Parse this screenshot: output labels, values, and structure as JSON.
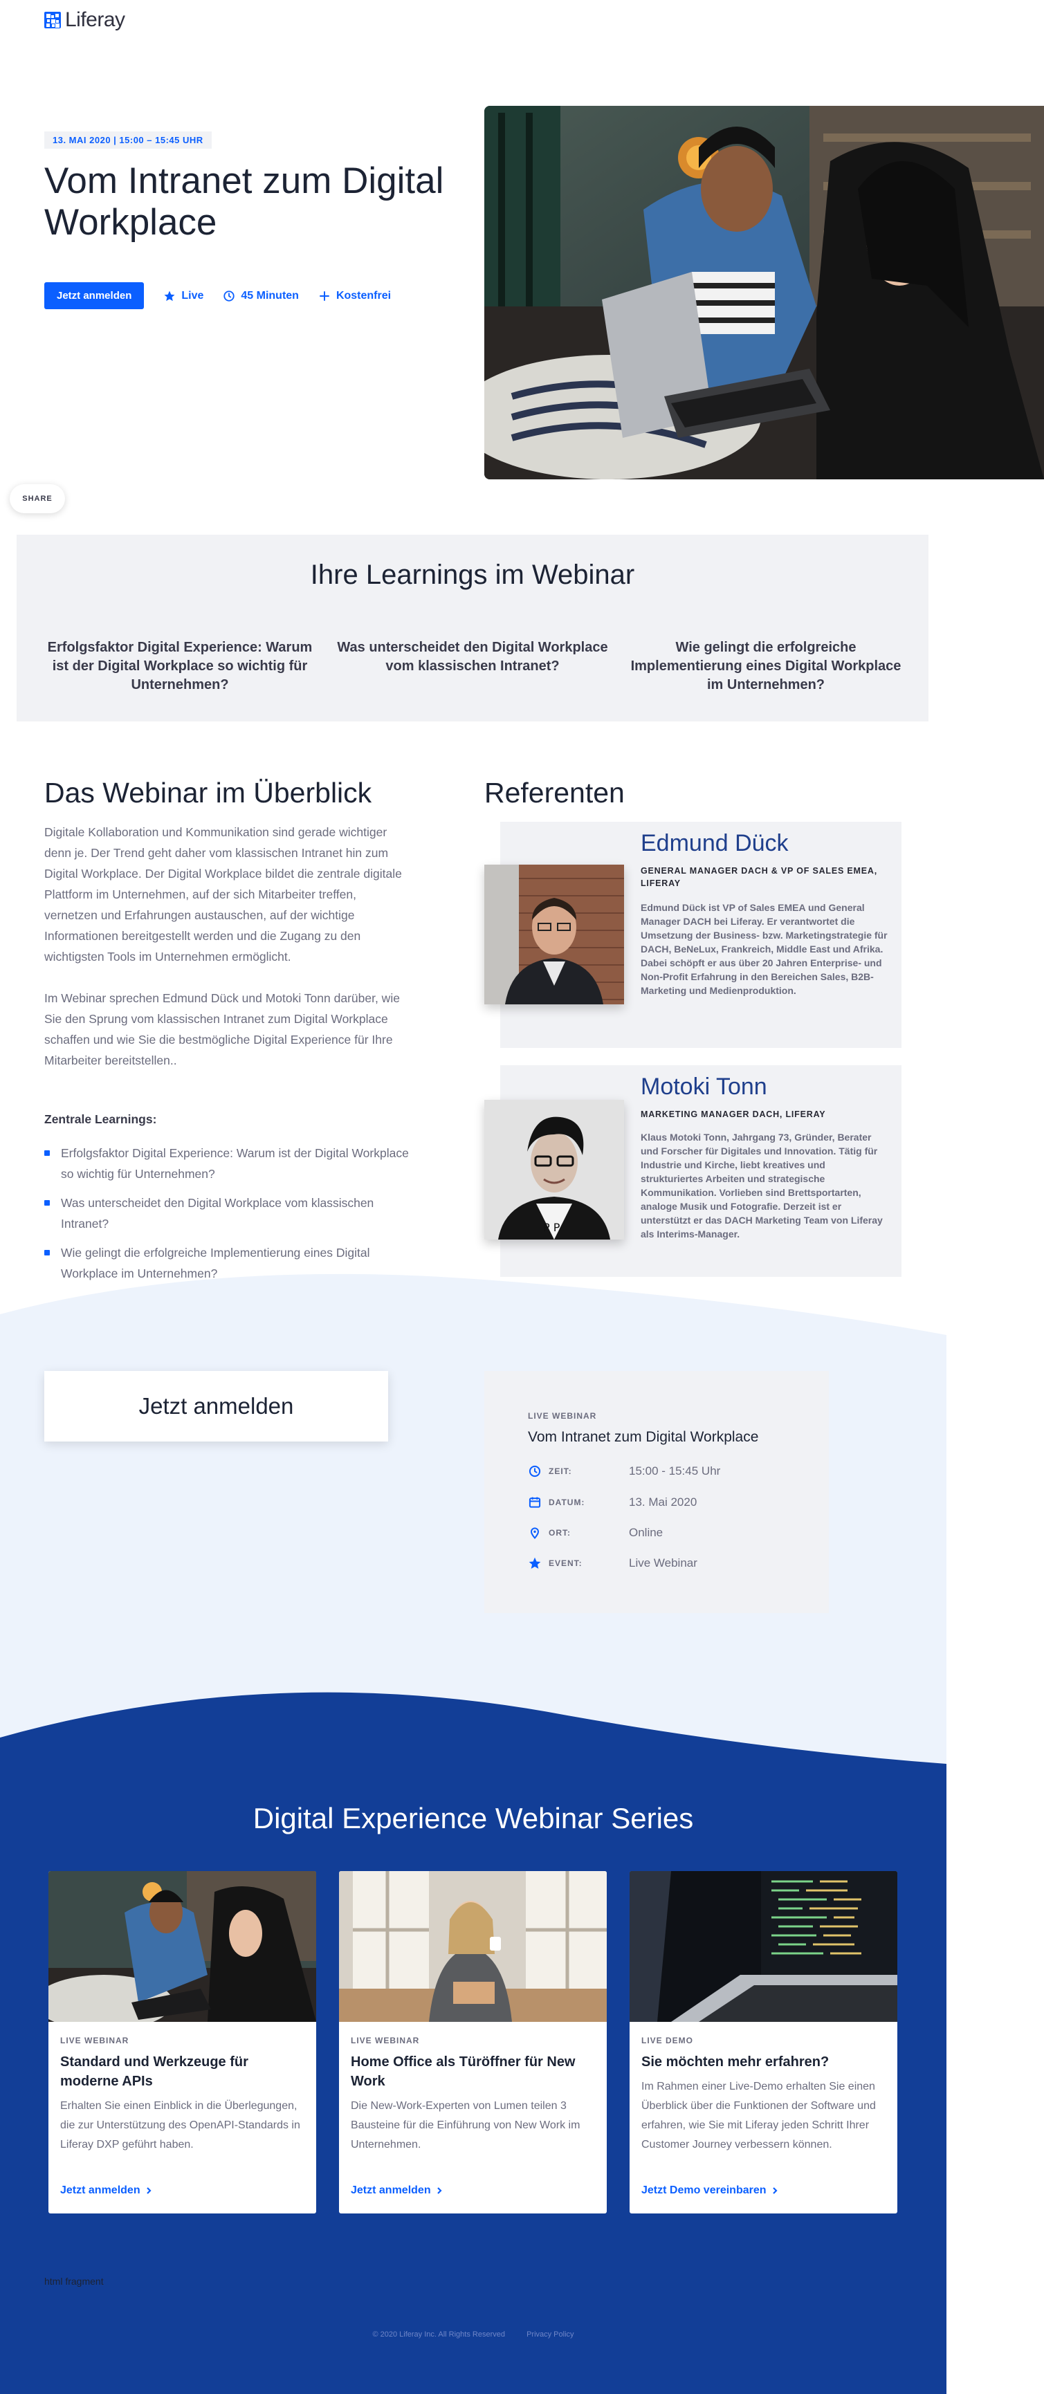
{
  "brand": {
    "name": "Liferay",
    "accent": "#0b5fff",
    "dark_blue": "#123e97"
  },
  "hero": {
    "date": "13. MAI 2020 | 15:00 – 15:45 UHR",
    "title": "Vom Intranet zum Digital Workplace",
    "register_label": "Jetzt anmelden",
    "meta": [
      {
        "icon": "star-icon",
        "label": "Live"
      },
      {
        "icon": "clock-icon",
        "label": "45 Minuten"
      },
      {
        "icon": "plus-icon",
        "label": "Kostenfrei"
      }
    ],
    "share_label": "SHARE"
  },
  "learnings": {
    "title": "Ihre Learnings im Webinar",
    "items": [
      "Erfolgsfaktor Digital Experience: Warum ist der Digital Workplace so wichtig für Unternehmen?",
      "Was unterscheidet den Digital Workplace vom klassischen Intranet?",
      "Wie gelingt die erfolgreiche Implementierung eines Digital Workplace im Unternehmen?"
    ]
  },
  "overview": {
    "title": "Das Webinar im Überblick",
    "paragraphs": [
      "Digitale Kollaboration und Kommunikation sind gerade wichtiger denn je. Der Trend geht daher vom klassischen Intranet hin zum Digital Workplace. Der Digital Workplace bildet die zentrale digitale Plattform im Unternehmen, auf der sich Mitarbeiter treffen, vernetzen und Erfahrungen austauschen, auf der wichtige Informationen bereitgestellt werden und die Zugang zu den wichtigsten Tools im Unternehmen ermöglicht.",
      "Im Webinar sprechen Edmund Dück und Motoki Tonn darüber, wie Sie den Sprung vom klassischen Intranet zum Digital Workplace schaffen und wie Sie die bestmögliche Digital Experience für Ihre Mitarbeiter bereitstellen.."
    ],
    "list_title": "Zentrale Learnings:",
    "list": [
      "Erfolgsfaktor Digital Experience: Warum ist der Digital Workplace so wichtig für Unternehmen?",
      "Was unterscheidet den Digital Workplace vom klassischen Intranet?",
      "Wie gelingt die erfolgreiche Implementierung eines Digital Workplace im Unternehmen?"
    ]
  },
  "speakers": {
    "title": "Referenten",
    "items": [
      {
        "name": "Edmund Dück",
        "role": "GENERAL MANAGER DACH & VP OF SALES EMEA, LIFERAY",
        "bio": "Edmund Dück ist VP of Sales EMEA und General Manager DACH bei Liferay. Er verantwortet die Umsetzung der Business- bzw. Marketingstrategie für DACH, BeNeLux, Frankreich, Middle East und Afrika. Dabei schöpft er aus über 20 Jahren Enterprise- und Non-Profit Erfahrung in den Bereichen Sales, B2B-Marketing und Medienproduktion."
      },
      {
        "name": "Motoki Tonn",
        "role": "MARKETING MANAGER DACH, LIFERAY",
        "bio": "Klaus Motoki Tonn, Jahrgang 73, Gründer, Berater und Forscher für Digitales und Innovation. Tätig für Industrie und Kirche, liebt kreatives und strukturiertes Arbeiten und strategische Kommunikation. Vorlieben sind Brettsportarten, analoge Musik und Fotografie. Derzeit ist er unterstützt er das DACH Marketing Team von Liferay als Interims-Manager."
      }
    ]
  },
  "registration": {
    "button_label": "Jetzt anmelden",
    "event": {
      "kicker": "LIVE WEBINAR",
      "title": "Vom Intranet zum Digital Workplace",
      "rows": [
        {
          "icon": "clock-icon",
          "label": "ZEIT:",
          "value": "15:00 - 15:45 Uhr"
        },
        {
          "icon": "calendar-icon",
          "label": "DATUM:",
          "value": "13. Mai 2020"
        },
        {
          "icon": "location-icon",
          "label": "ORT:",
          "value": "Online"
        },
        {
          "icon": "star-icon",
          "label": "EVENT:",
          "value": "Live Webinar"
        }
      ]
    }
  },
  "series": {
    "title": "Digital Experience Webinar Series",
    "cards": [
      {
        "kicker": "LIVE WEBINAR",
        "title": "Standard und Werkzeuge für moderne APIs",
        "text": "Erhalten Sie einen Einblick in die Überlegungen, die zur Unterstützung des OpenAPI-Standards in Liferay DXP geführt haben.",
        "link": "Jetzt anmelden"
      },
      {
        "kicker": "LIVE WEBINAR",
        "title": "Home Office als Türöffner für New Work",
        "text": "Die New-Work-Experten von Lumen teilen 3 Bausteine für die Einführung von New Work im Unternehmen.",
        "link": "Jetzt anmelden"
      },
      {
        "kicker": "LIVE DEMO",
        "title": "Sie möchten mehr erfahren?",
        "text": "Im Rahmen einer Live-Demo erhalten Sie einen Überblick über die Funktionen der Software und erfahren, wie Sie mit Liferay jeden Schritt Ihrer Customer Journey verbessern können.",
        "link": "Jetzt Demo vereinbaren"
      }
    ]
  },
  "fragment_label": "html fragment",
  "footer": {
    "copyright": "© 2020 Liferay Inc. All Rights Reserved",
    "privacy": "Privacy Policy"
  }
}
